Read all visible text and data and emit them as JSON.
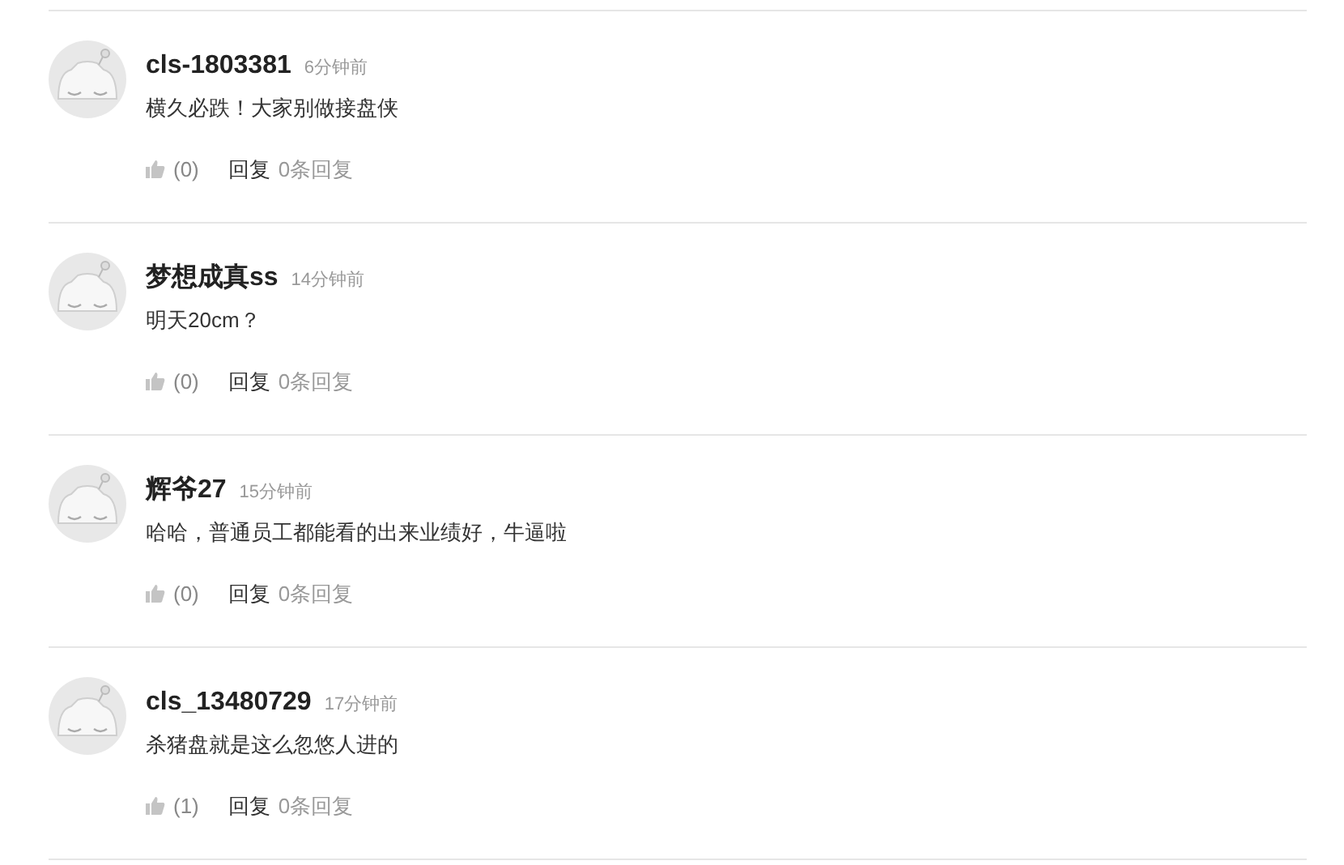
{
  "comments": [
    {
      "username": "cls-1803381",
      "time": "6分钟前",
      "text": "横久必跌！大家别做接盘侠",
      "likes": "(0)",
      "reply": "回复",
      "reply_count": "0条回复"
    },
    {
      "username": "梦想成真ss",
      "time": "14分钟前",
      "text": "明天20cm？",
      "likes": "(0)",
      "reply": "回复",
      "reply_count": "0条回复"
    },
    {
      "username": "辉爷27",
      "time": "15分钟前",
      "text": "哈哈，普通员工都能看的出来业绩好，牛逼啦",
      "likes": "(0)",
      "reply": "回复",
      "reply_count": "0条回复"
    },
    {
      "username": "cls_13480729",
      "time": "17分钟前",
      "text": "杀猪盘就是这么忽悠人进的",
      "likes": "(1)",
      "reply": "回复",
      "reply_count": "0条回复"
    }
  ]
}
